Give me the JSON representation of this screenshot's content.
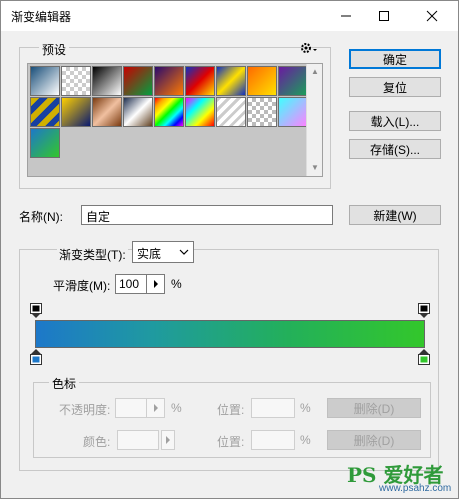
{
  "window": {
    "title": "渐变编辑器"
  },
  "presets": {
    "label": "预设",
    "gear_icon": "gear-icon",
    "swatches": [
      {
        "name": "blue-white",
        "bg": "linear-gradient(135deg,#1a4f7a,#ffffff)"
      },
      {
        "name": "transparent",
        "bg": "repeating-conic-gradient(#ccc 0% 25%, #fff 0% 50%) 0 0/8px 8px"
      },
      {
        "name": "black-white",
        "bg": "linear-gradient(135deg,#000,#fff)"
      },
      {
        "name": "red-green",
        "bg": "linear-gradient(135deg,#c80000,#00a040)"
      },
      {
        "name": "violet-orange",
        "bg": "linear-gradient(135deg,#2a0a6e,#ff7a00)"
      },
      {
        "name": "blue-red-yellow",
        "bg": "linear-gradient(135deg,#1030c0,#e00000,#ffe000)"
      },
      {
        "name": "blue-yellow-blue",
        "bg": "linear-gradient(135deg,#1030c0,#ffe000,#1030c0)"
      },
      {
        "name": "orange-yellow",
        "bg": "linear-gradient(135deg,#ff6a00,#ffe000)"
      },
      {
        "name": "violet-green",
        "bg": "linear-gradient(135deg,#6a1aa0,#1aa05a)"
      },
      {
        "name": "steel-bar",
        "bg": "repeating-linear-gradient(135deg,#d0b000 0 6px,#1840a0 6px 12px)"
      },
      {
        "name": "yellow-violet",
        "bg": "linear-gradient(135deg,#ffd000,#0a1a70)"
      },
      {
        "name": "copper",
        "bg": "linear-gradient(135deg,#7a3a10,#f0c0a0,#7a3a10)"
      },
      {
        "name": "chrome",
        "bg": "linear-gradient(135deg,#203050,#fff,#604020)"
      },
      {
        "name": "spectrum",
        "bg": "linear-gradient(135deg,red,orange,yellow,lime,cyan,blue,magenta)"
      },
      {
        "name": "transparent-rainbow",
        "bg": "linear-gradient(135deg,#ff00ff,#00ffff,#ffff00,#ff0000)"
      },
      {
        "name": "transparent-stripes",
        "bg": "repeating-linear-gradient(135deg,#ccc 0 3px,#fff 3px 7px)"
      },
      {
        "name": "neutral-density",
        "bg": "repeating-conic-gradient(#bbb 0% 25%, #fff 0% 50%) 0 0/8px 8px"
      },
      {
        "name": "cyan-violet",
        "bg": "linear-gradient(135deg,#40ffff,#ff80ff)"
      },
      {
        "name": "custom-blue-green",
        "bg": "linear-gradient(135deg,#1d78c9,#33c72b)"
      }
    ]
  },
  "buttons": {
    "ok": "确定",
    "reset": "复位",
    "load": "载入(L)...",
    "save": "存储(S)...",
    "new": "新建(W)",
    "delete1": "删除(D)",
    "delete2": "删除(D)"
  },
  "name_field": {
    "label": "名称(N):",
    "value": "自定"
  },
  "gradient": {
    "type_label": "渐变类型(T):",
    "type_value": "实底",
    "smoothness_label": "平滑度(M):",
    "smoothness_value": "100",
    "percent": "%",
    "start_color": "#1d78c9",
    "end_color": "#33c72b"
  },
  "color_stops": {
    "label": "色标",
    "opacity_label": "不透明度:",
    "opacity_unit": "%",
    "location_label_1": "位置:",
    "location_unit_1": "%",
    "color_label": "颜色:",
    "location_label_2": "位置:",
    "location_unit_2": "%"
  },
  "watermark": {
    "text": "PS 爱好者",
    "url": "www.psahz.com"
  }
}
